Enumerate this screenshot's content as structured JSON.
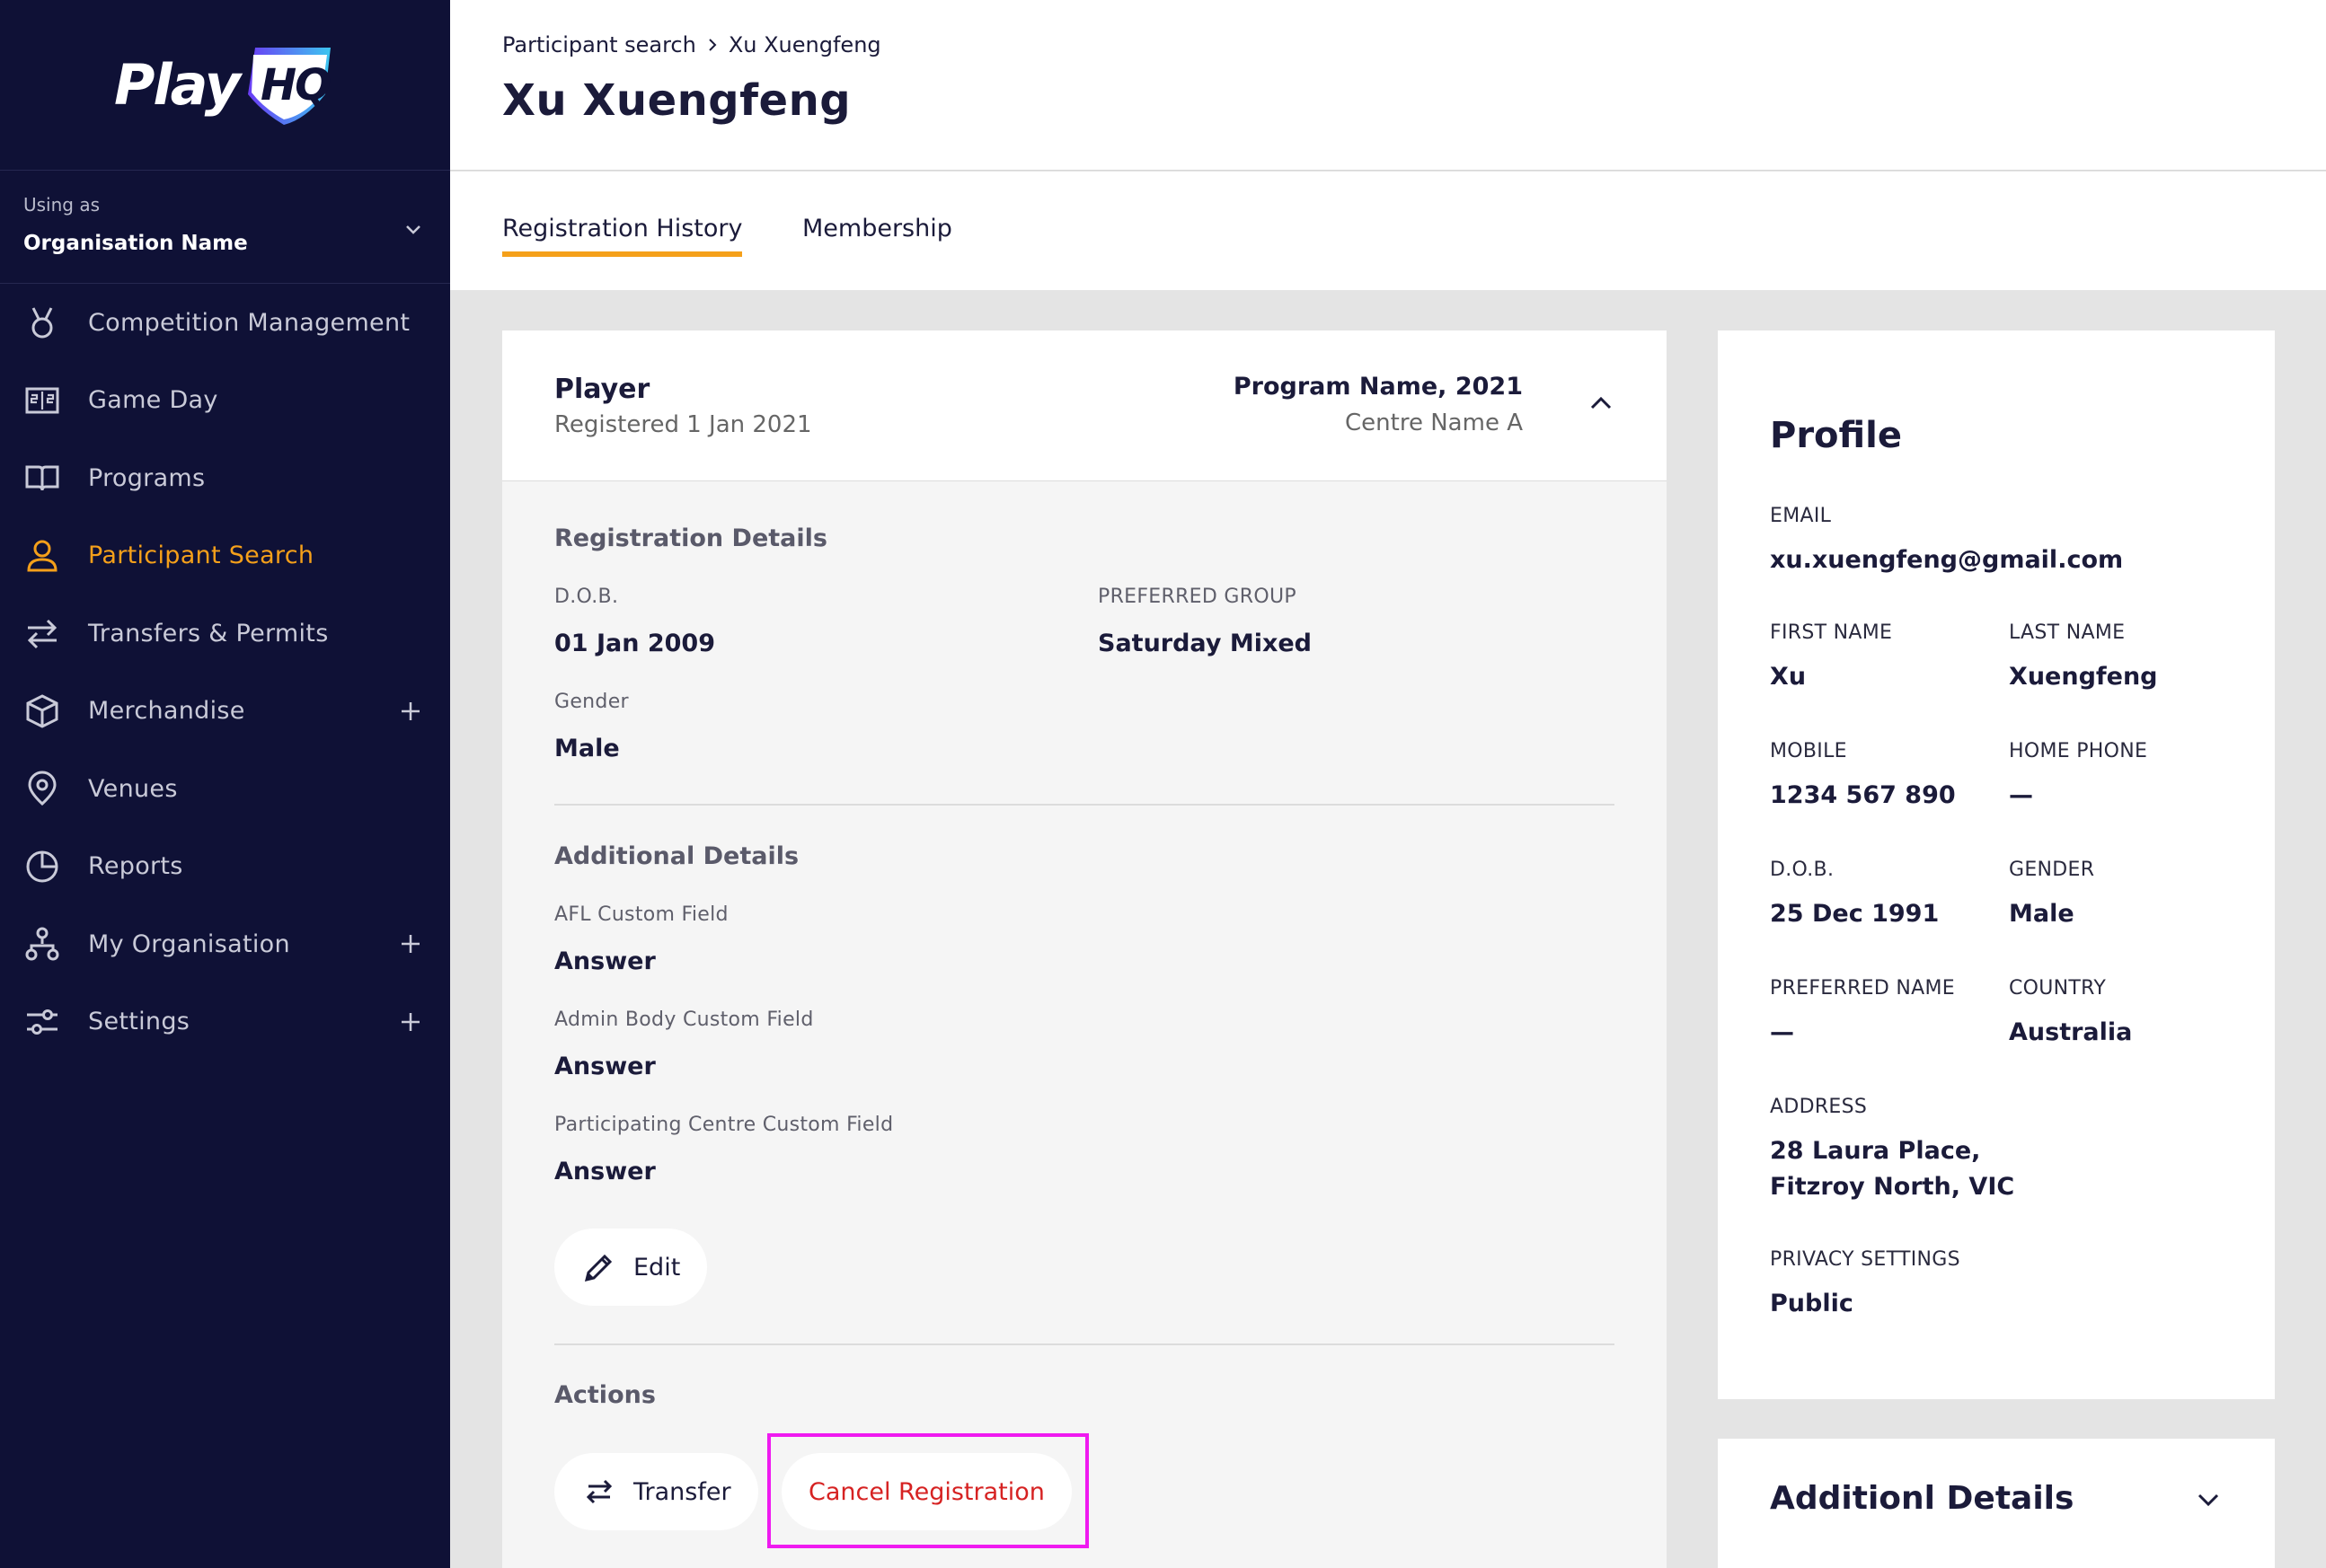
{
  "brand": {
    "logo_text": "Play",
    "logo_mark": "HQ",
    "accent": "#f5a01a",
    "sidebar_bg": "#0f1136",
    "cancel_color": "#d62222"
  },
  "org": {
    "using_as": "Using as",
    "name": "Organisation Name"
  },
  "nav": [
    {
      "label": "Competition Management",
      "icon": "medal-icon"
    },
    {
      "label": "Game Day",
      "icon": "scoreboard-icon"
    },
    {
      "label": "Programs",
      "icon": "book-icon"
    },
    {
      "label": "Participant Search",
      "icon": "person-icon",
      "active": true
    },
    {
      "label": "Transfers & Permits",
      "icon": "transfer-arrows-icon"
    },
    {
      "label": "Merchandise",
      "icon": "box-icon",
      "expandable": true
    },
    {
      "label": "Venues",
      "icon": "location-pin-icon"
    },
    {
      "label": "Reports",
      "icon": "pie-chart-icon"
    },
    {
      "label": "My Organisation",
      "icon": "org-tree-icon",
      "expandable": true
    },
    {
      "label": "Settings",
      "icon": "sliders-icon",
      "expandable": true
    }
  ],
  "breadcrumb": {
    "parent": "Participant search",
    "current": "Xu Xuengfeng"
  },
  "page_title": "Xu Xuengfeng",
  "tabs": [
    {
      "label": "Registration History",
      "active": true
    },
    {
      "label": "Membership"
    }
  ],
  "registration": {
    "role": "Player",
    "registered": "Registered 1 Jan 2021",
    "program": "Program Name, 2021",
    "centre": "Centre Name A",
    "details_title": "Registration Details",
    "dob_label": "D.O.B.",
    "dob": "01 Jan 2009",
    "group_label": "PREFERRED GROUP",
    "group": "Saturday Mixed",
    "gender_label": "Gender",
    "gender": "Male",
    "additional_title": "Additional Details",
    "custom_fields": [
      {
        "label": "AFL Custom Field",
        "value": "Answer"
      },
      {
        "label": "Admin Body Custom Field",
        "value": "Answer"
      },
      {
        "label": "Participating Centre Custom Field",
        "value": "Answer"
      }
    ],
    "edit_label": "Edit",
    "actions_title": "Actions",
    "transfer_label": "Transfer",
    "cancel_label": "Cancel Registration"
  },
  "profile": {
    "title": "Profile",
    "email_label": "EMAIL",
    "email": "xu.xuengfeng@gmail.com",
    "first_name_label": "FIRST NAME",
    "first_name": "Xu",
    "last_name_label": "LAST NAME",
    "last_name": "Xuengfeng",
    "mobile_label": "MOBILE",
    "mobile": "1234 567 890",
    "home_phone_label": "HOME PHONE",
    "home_phone": "—",
    "dob_label": "D.O.B.",
    "dob": "25 Dec 1991",
    "gender_label": "GENDER",
    "gender": "Male",
    "preferred_name_label": "PREFERRED NAME",
    "preferred_name": "—",
    "country_label": "COUNTRY",
    "country": "Australia",
    "address_label": "ADDRESS",
    "address_line1": "28 Laura Place,",
    "address_line2": "Fitzroy North, VIC",
    "privacy_label": "PRIVACY SETTINGS",
    "privacy": "Public"
  },
  "additional_card": {
    "title": "Additionl Details"
  }
}
